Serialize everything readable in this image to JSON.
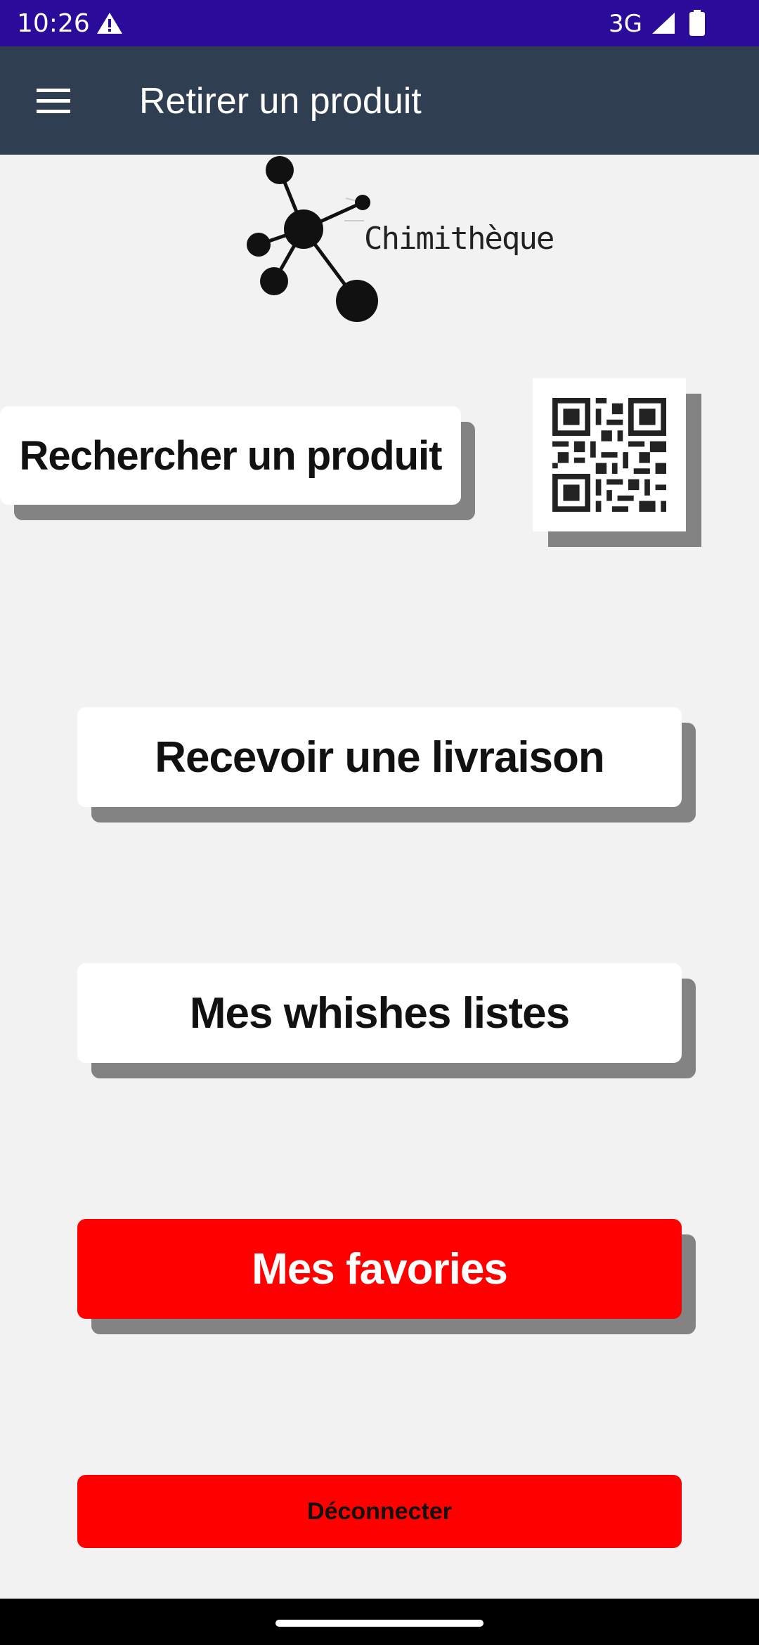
{
  "status_bar": {
    "time": "10:26",
    "network": "3G",
    "icons": [
      "warning-icon",
      "signal-icon",
      "battery-icon"
    ]
  },
  "app_bar": {
    "title": "Retirer un produit",
    "menu_icon": "menu-icon"
  },
  "logo": {
    "text": "Chimithèque"
  },
  "buttons": {
    "search": "Rechercher un produit",
    "qr_icon": "qr-code-icon",
    "delivery": "Recevoir une livraison",
    "wishlists": "Mes whishes listes",
    "favorites": "Mes favories",
    "logout": "Déconnecter"
  },
  "colors": {
    "status_bar": "#2a0b9a",
    "app_bar": "#2f3e51",
    "background": "#f2f2f2",
    "accent_red": "#ff0000",
    "shadow": "#838383"
  }
}
